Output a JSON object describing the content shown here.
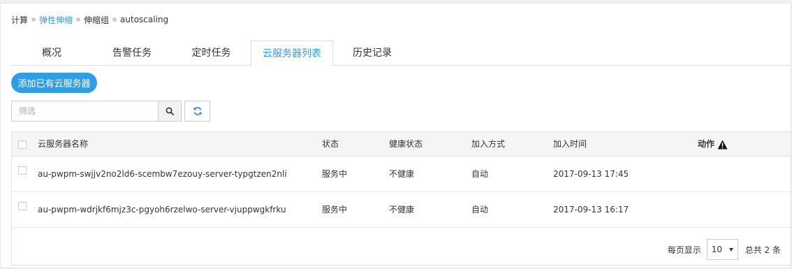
{
  "breadcrumb": {
    "items": [
      "计算",
      "弹性伸缩",
      "伸缩组",
      "autoscaling"
    ]
  },
  "tabs": [
    "概况",
    "告警任务",
    "定时任务",
    "云服务器列表",
    "历史记录"
  ],
  "active_tab": "云服务器列表",
  "add_button": "添加已有云服务器",
  "filter": {
    "placeholder": "筛选",
    "value": ""
  },
  "icons": {
    "search": "search-icon",
    "refresh": "refresh-icon",
    "warning": "warning-icon",
    "dropdown": "chevron-down-icon"
  },
  "colors": {
    "accent": "#2f9ee6"
  },
  "table": {
    "headers": {
      "name": "云服务器名称",
      "status": "状态",
      "health": "健康状态",
      "join": "加入方式",
      "time": "加入时间",
      "action": "动作"
    },
    "rows": [
      {
        "name": "au-pwpm-swjjv2no2ld6-scembw7ezouy-server-typgtzen2nli",
        "status": "服务中",
        "health": "不健康",
        "join": "自动",
        "time": "2017-09-13 17:45"
      },
      {
        "name": "au-pwpm-wdrjkf6mjz3c-pgyoh6rzelwo-server-vjuppwgkfrku",
        "status": "服务中",
        "health": "不健康",
        "join": "自动",
        "time": "2017-09-13 16:17"
      }
    ]
  },
  "pagination": {
    "per_page_label": "每页显示",
    "per_page_value": "10",
    "total_label": "总共 2 条"
  }
}
